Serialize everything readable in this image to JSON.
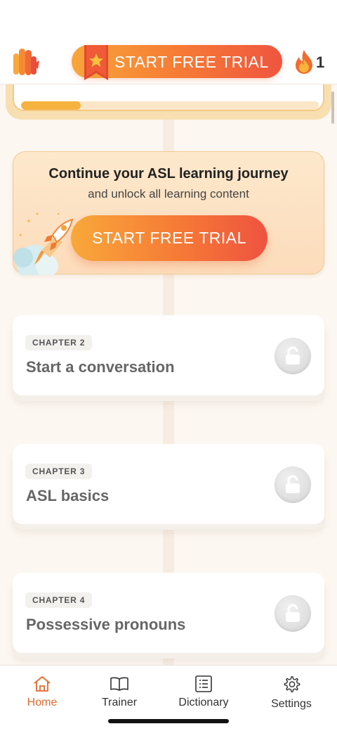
{
  "header": {
    "trial_button": "START FREE TRIAL",
    "streak_count": "1",
    "colors": {
      "accent": "#f67c35",
      "accent_end": "#ef553f"
    }
  },
  "previous_chapter": {
    "progress": 0.2
  },
  "promo": {
    "title": "Continue your ASL learning journey",
    "subtitle": "and unlock all learning content",
    "cta": "START FREE TRIAL",
    "icon": "rocket-icon"
  },
  "chapters": [
    {
      "badge": "CHAPTER 2",
      "name": "Start a conversation",
      "locked": true
    },
    {
      "badge": "CHAPTER 3",
      "name": "ASL basics",
      "locked": true
    },
    {
      "badge": "CHAPTER 4",
      "name": "Possessive pronouns",
      "locked": true
    }
  ],
  "tabbar": {
    "items": [
      {
        "label": "Home",
        "icon": "home-icon",
        "active": true
      },
      {
        "label": "Trainer",
        "icon": "book-icon",
        "active": false
      },
      {
        "label": "Dictionary",
        "icon": "list-icon",
        "active": false
      },
      {
        "label": "Settings",
        "icon": "gear-icon",
        "active": false
      }
    ]
  }
}
